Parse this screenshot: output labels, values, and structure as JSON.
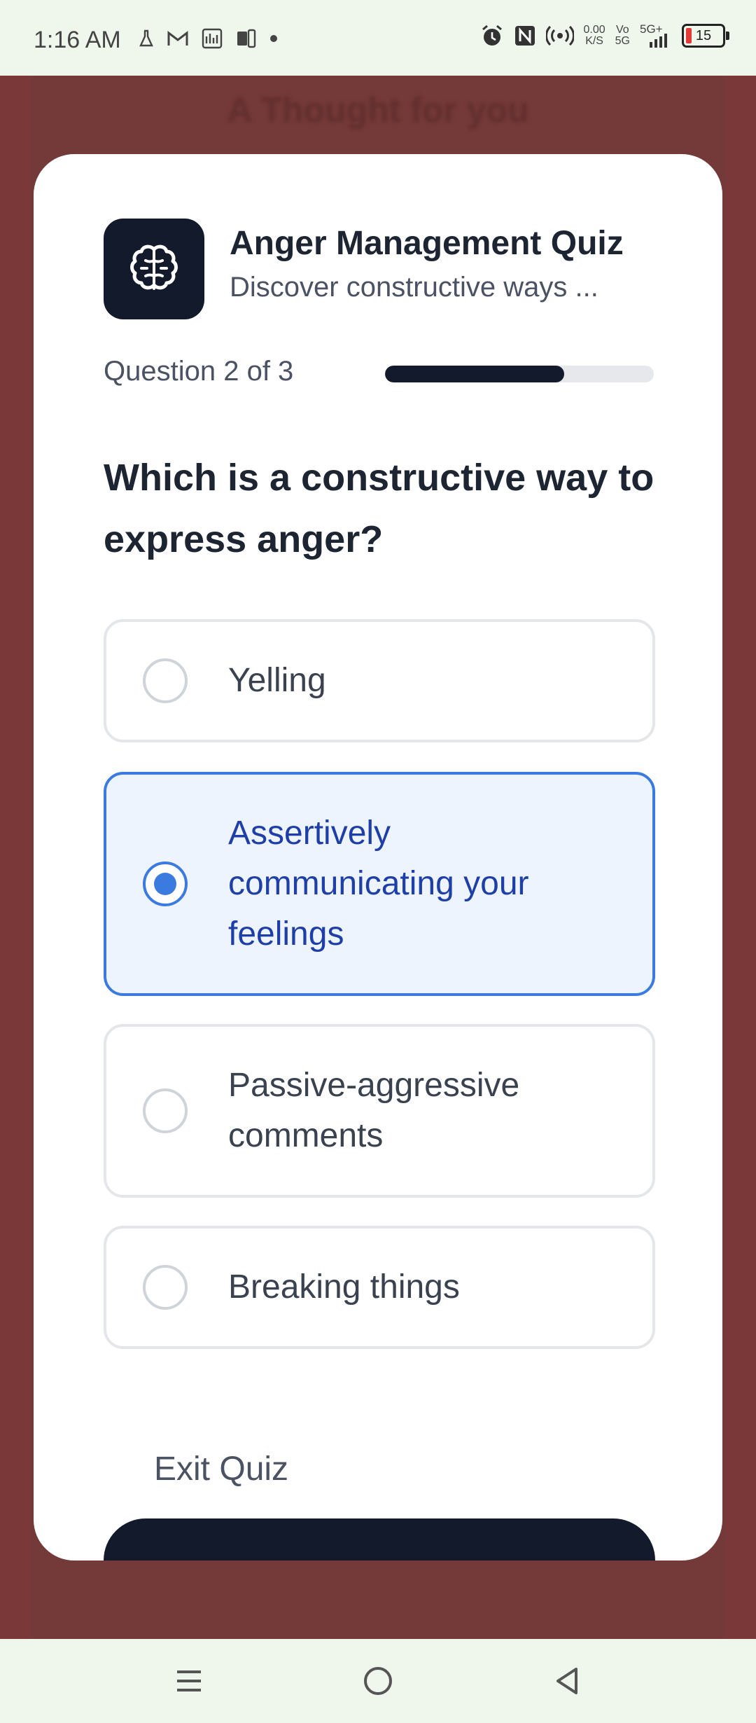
{
  "status_bar": {
    "time": "1:16 AM",
    "net_speed_value": "0.00",
    "net_speed_unit": "K/S",
    "network_top": "Vo",
    "network_bottom": "5G",
    "network_type": "5G+",
    "battery_level": "15",
    "icons": [
      "flask-icon",
      "gmail-icon",
      "chart-icon",
      "phone-link-icon",
      "dot-icon",
      "alarm-icon",
      "nfc-icon",
      "hotspot-icon",
      "signal-icon",
      "battery-icon"
    ]
  },
  "background": {
    "title": "A Thought for you"
  },
  "quiz": {
    "title": "Anger Management Quiz",
    "subtitle": "Discover constructive ways ...",
    "progress_label": "Question 2 of 3",
    "progress_fraction": 0.667,
    "question": "Which is a constructive way to express anger?",
    "options": [
      {
        "label": "Yelling",
        "selected": false
      },
      {
        "label": "Assertively communicating your feelings",
        "selected": true
      },
      {
        "label": "Passive-aggressive comments",
        "selected": false
      },
      {
        "label": "Breaking things",
        "selected": false
      }
    ],
    "exit_label": "Exit Quiz",
    "app_icon": "brain-icon"
  },
  "colors": {
    "accent": "#3b7be0",
    "dark": "#121a2b",
    "backdrop": "#7b3838"
  },
  "nav_bar": {
    "icons": [
      "menu-icon",
      "home-icon",
      "back-icon"
    ]
  }
}
